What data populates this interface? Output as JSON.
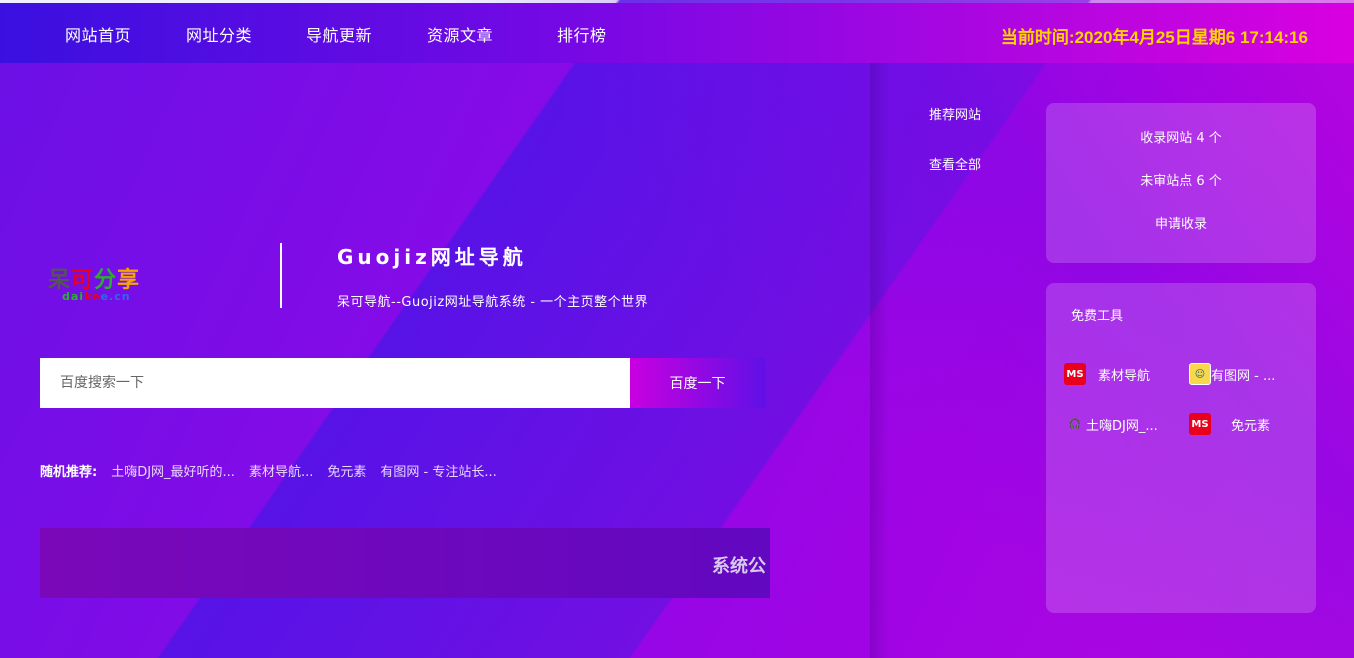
{
  "nav": {
    "items": [
      "网站首页",
      "网址分类",
      "导航更新",
      "资源文章",
      "排行榜"
    ],
    "clock": "当前时间:2020年4月25日星期6 17:14:16"
  },
  "brand": {
    "logo_text": "呆可分享",
    "logo_domain": "daikee.cn",
    "title": "Guojiz网址导航",
    "subtitle": "呆可导航--Guojiz网址导航系统 - 一个主页整个世界"
  },
  "search": {
    "placeholder": "百度搜索一下",
    "button_label": "百度一下"
  },
  "random": {
    "label": "随机推荐:",
    "links": [
      "土嗨DJ网_最好听的...",
      "素材导航...",
      "免元素",
      "有图网 - 专注站长..."
    ]
  },
  "notice": {
    "text": "系统公"
  },
  "side": {
    "recommend": "推荐网站",
    "view_all": "查看全部"
  },
  "stats": {
    "included": "收录网站 4 个",
    "pending": "未审站点 6 个",
    "apply": "申请收录"
  },
  "tools": {
    "title": "免费工具",
    "items": [
      {
        "name": "素材导航",
        "icon": "ms-red-icon"
      },
      {
        "name": "有图网 - ...",
        "icon": "yellow-face-icon"
      },
      {
        "name": "土嗨DJ网_...",
        "icon": "headphones-icon"
      },
      {
        "name": "免元素",
        "icon": "ms-red-icon"
      }
    ]
  },
  "colors": {
    "clock": "#ffd200",
    "accent_start": "#c800e0",
    "accent_end": "#6010e6"
  }
}
